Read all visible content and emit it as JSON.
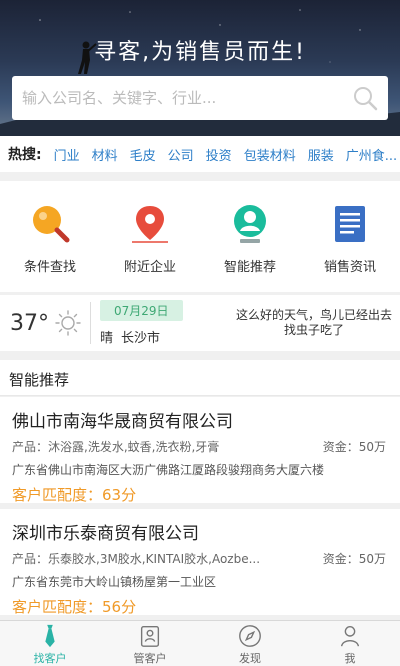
{
  "hero": {
    "title": "寻客,为销售员而生!",
    "search_placeholder": "输入公司名、关键字、行业..."
  },
  "hot_search": {
    "label": "热搜:",
    "tags": [
      "门业",
      "材料",
      "毛皮",
      "公司",
      "投资",
      "包装材料",
      "服装",
      "广州食..."
    ]
  },
  "features": [
    {
      "label": "条件查找",
      "icon": "magnifier-icon"
    },
    {
      "label": "附近企业",
      "icon": "location-pin-icon"
    },
    {
      "label": "智能推荐",
      "icon": "user-recommend-icon"
    },
    {
      "label": "销售资讯",
      "icon": "news-document-icon"
    }
  ],
  "weather": {
    "temperature": "37°",
    "date": "07月29日",
    "condition": "晴",
    "city": "长沙市",
    "message": "这么好的天气，鸟儿已经出去找虫子吃了"
  },
  "recommend": {
    "title": "智能推荐",
    "companies": [
      {
        "name": "佛山市南海华晟商贸有限公司",
        "products": "产品：沐浴露,洗发水,蚊香,洗衣粉,牙膏",
        "capital": "资金：50万",
        "address": "广东省佛山市南海区大沥广佛路江厦路段骏翔商务大厦六楼",
        "match": "客户匹配度：63分"
      },
      {
        "name": "深圳市乐泰商贸有限公司",
        "products": "产品：乐泰胶水,3M胶水,KINTAI胶水,Aozbe...",
        "capital": "资金：50万",
        "address": "广东省东莞市大岭山镇杨屋第一工业区",
        "match": "客户匹配度：56分"
      }
    ]
  },
  "tabbar": {
    "tabs": [
      {
        "label": "找客户",
        "icon": "tie-icon",
        "active": true
      },
      {
        "label": "管客户",
        "icon": "contacts-icon",
        "active": false
      },
      {
        "label": "发现",
        "icon": "compass-icon",
        "active": false
      },
      {
        "label": "我",
        "icon": "person-icon",
        "active": false
      }
    ]
  },
  "colors": {
    "accent": "#2ab3a6",
    "link": "#2e7fc8",
    "match": "#f09a28",
    "date_badge_bg": "#d7f1e3"
  }
}
